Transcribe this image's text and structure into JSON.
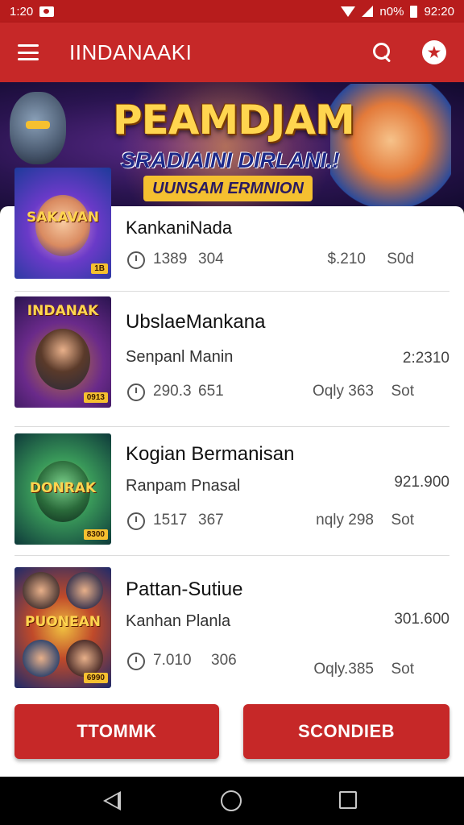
{
  "status_bar": {
    "time": "1:20",
    "battery_text": "n0%",
    "clock": "92:20"
  },
  "app_bar": {
    "title": "IINDANAAKI",
    "profile_glyph": "★"
  },
  "banner": {
    "title": "PEAMDJAM",
    "subtitle": "SRADIAINI DIRLANI.!",
    "tagline": "UUNSAM ERMNION"
  },
  "items": [
    {
      "title": "KankaniNada",
      "subtitle": "",
      "price": "",
      "plays": "1389",
      "size": "304",
      "tag": "$.210",
      "sort": "S0d",
      "thumb_label": "SAKAVAN",
      "thumb_badge": "1B"
    },
    {
      "title": "UbslaeMankana",
      "subtitle": "Senpanl Manin",
      "price": "2:2310",
      "plays": "290.3",
      "size": "651",
      "tag": "Oqly 363",
      "sort": "Sot",
      "thumb_label": "INDANAK",
      "thumb_badge": "0913"
    },
    {
      "title": "Kogian Bermanisan",
      "subtitle": "Ranpam Pnasal",
      "price": "921.900",
      "plays": "1517",
      "size": "367",
      "tag": "nqly 298",
      "sort": "Sot",
      "thumb_label": "DONRAK",
      "thumb_badge": "8300"
    },
    {
      "title": "Pattan-Sutiue",
      "subtitle": "Kanhan Planla",
      "price": "301.600",
      "plays": "7.010",
      "size": "306",
      "tag": "Oqly.385",
      "sort": "Sot",
      "thumb_label": "PUONEAN",
      "thumb_badge": "6990"
    }
  ],
  "buttons": {
    "left": "TTOMMK",
    "right": "SCONDIEB"
  },
  "colors": {
    "primary": "#c62828",
    "status": "#b71c1c",
    "accent": "#f5c030"
  }
}
